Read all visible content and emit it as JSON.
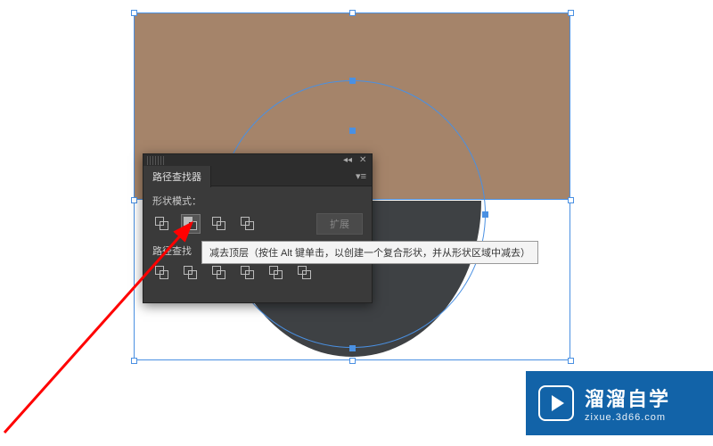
{
  "panel": {
    "title": "路径查找器",
    "shape_mode_label": "形状模式：",
    "pathfinder_label": "路径查找",
    "expand_label": "扩展",
    "shape_modes": [
      {
        "name": "unite"
      },
      {
        "name": "minus-front"
      },
      {
        "name": "intersect"
      },
      {
        "name": "exclude"
      }
    ],
    "pathfinders": [
      {
        "name": "divide"
      },
      {
        "name": "trim"
      },
      {
        "name": "merge"
      },
      {
        "name": "crop"
      },
      {
        "name": "outline"
      },
      {
        "name": "minus-back"
      }
    ]
  },
  "tooltip": {
    "text": "减去顶层（按住 Alt 键单击，以创建一个复合形状，并从形状区域中减去）"
  },
  "watermark": {
    "title": "溜溜自学",
    "url": "zixue.3d66.com"
  },
  "colors": {
    "rect": "#a5846a",
    "semicircle": "#3e4144",
    "selection": "#4a90e2"
  }
}
